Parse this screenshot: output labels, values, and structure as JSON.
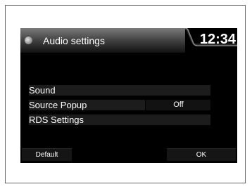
{
  "header": {
    "title": "Audio settings",
    "clock": "12:34",
    "icon": "audio-settings-icon"
  },
  "menu": {
    "items": [
      {
        "label": "Sound",
        "value": ""
      },
      {
        "label": "Source Popup",
        "value": "Off"
      },
      {
        "label": "RDS Settings",
        "value": ""
      }
    ]
  },
  "footer": {
    "default_label": "Default",
    "ok_label": "OK"
  },
  "colors": {
    "screen_background": "#000000",
    "text": "#ffffff",
    "row_background": "#1c1c1c",
    "header_gradient_light": "#7a7a7a"
  }
}
